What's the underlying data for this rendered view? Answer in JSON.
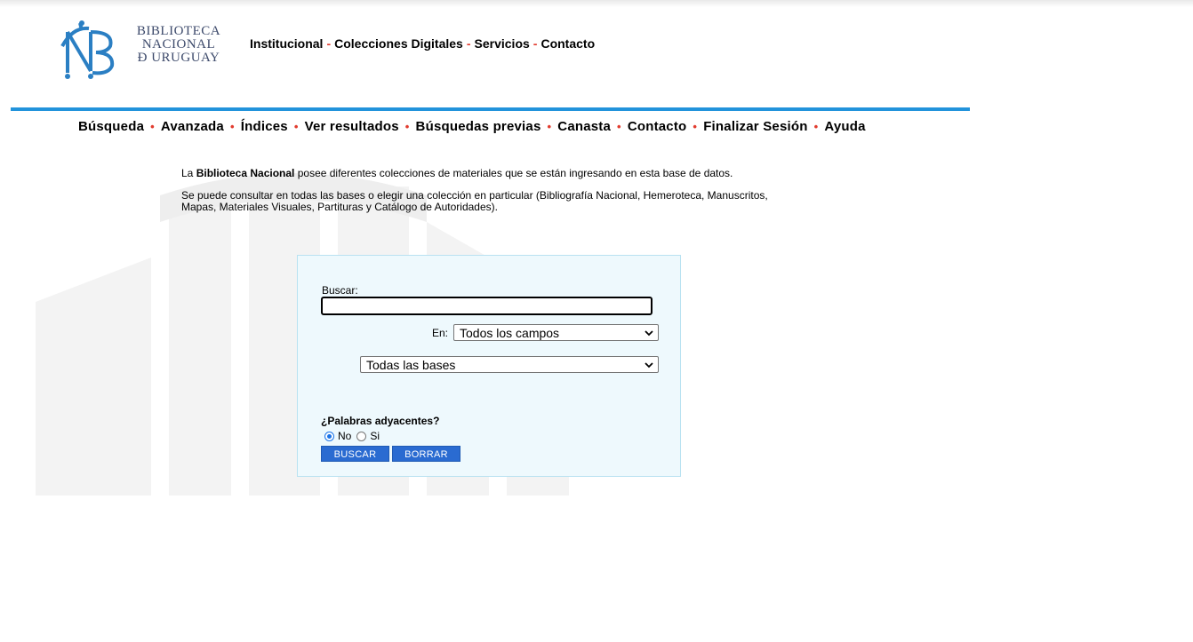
{
  "logo": {
    "line1": "BIBLIOTECA",
    "line2": "NACIONAL",
    "line3": "Ð URUGUAY",
    "icon": "biblioteca-nacional-monogram"
  },
  "top_nav": {
    "items": [
      "Institucional",
      "Colecciones Digitales",
      "Servicios",
      "Contacto"
    ],
    "separator": "-"
  },
  "sub_nav": {
    "items": [
      "Búsqueda",
      "Avanzada",
      "Índices",
      "Ver resultados",
      "Búsquedas previas",
      "Canasta",
      "Contacto",
      "Finalizar Sesión",
      "Ayuda"
    ],
    "separator": "•"
  },
  "intro": {
    "p1_before": "La ",
    "p1_bold": "Biblioteca Nacional",
    "p1_after": " posee diferentes colecciones de materiales que se están ingresando en esta base de datos.",
    "p2": "Se puede consultar en todas las bases o elegir una colección en particular (Bibliografía Nacional, Hemeroteca, Manuscritos, Mapas, Materiales Visuales, Partituras y Catálogo de Autoridades)."
  },
  "search": {
    "buscar_label": "Buscar:",
    "buscar_value": "",
    "en_label": "En:",
    "campo_selected": "Todos los campos",
    "base_selected": "Todas las bases",
    "adjacent_label": "¿Palabras adyacentes?",
    "option_no": "No",
    "option_si": "Si",
    "selected_option": "No",
    "buscar_button": "BUSCAR",
    "borrar_button": "BORRAR"
  },
  "colors": {
    "accent_line": "#2293db",
    "separator": "#e23c2f",
    "button": "#2a6bd1",
    "panel_bg": "#eef9fd",
    "logo_blue": "#2b7fc3"
  }
}
